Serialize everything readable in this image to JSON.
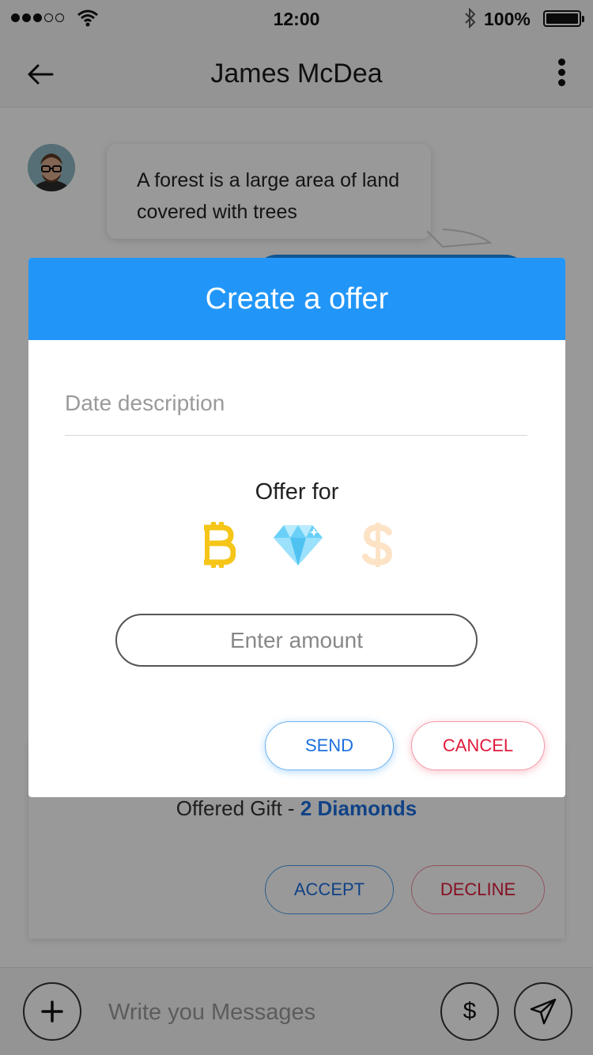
{
  "status_bar": {
    "time": "12:00",
    "battery_percent": "100%",
    "signal_bars_filled": 3,
    "signal_bars_total": 5,
    "icons": [
      "signal-dots-icon",
      "wifi-icon",
      "bluetooth-icon",
      "battery-icon"
    ]
  },
  "header": {
    "contact_name": "James McDea",
    "back_icon": "arrow-left-icon",
    "menu_icon": "more-vertical-icon"
  },
  "chat": {
    "incoming_message": "A forest is a large area of land covered with trees",
    "offer_card": {
      "offered_prefix": "Offered Gift - ",
      "offered_value": "2 Diamonds",
      "accept_label": "ACCEPT",
      "decline_label": "DECLINE"
    }
  },
  "input_bar": {
    "placeholder": "Write you Messages",
    "dollar_label": "$",
    "add_icon": "plus-icon",
    "send_icon": "paper-plane-icon"
  },
  "modal": {
    "title": "Create a offer",
    "description_placeholder": "Date description",
    "offer_for_label": "Offer for",
    "currencies": [
      "bitcoin-icon",
      "diamond-icon",
      "dollar-icon"
    ],
    "amount_placeholder": "Enter amount",
    "send_label": "SEND",
    "cancel_label": "CANCEL"
  },
  "colors": {
    "modal_header": "#2196f8",
    "send_accent": "#1b6fe0",
    "cancel_accent": "#e01a3a",
    "bitcoin": "#f5c518",
    "diamond": "#6ad0f8",
    "dollar_faded": "#fde3c6",
    "overlay": "rgba(0,0,0,0.40)"
  }
}
